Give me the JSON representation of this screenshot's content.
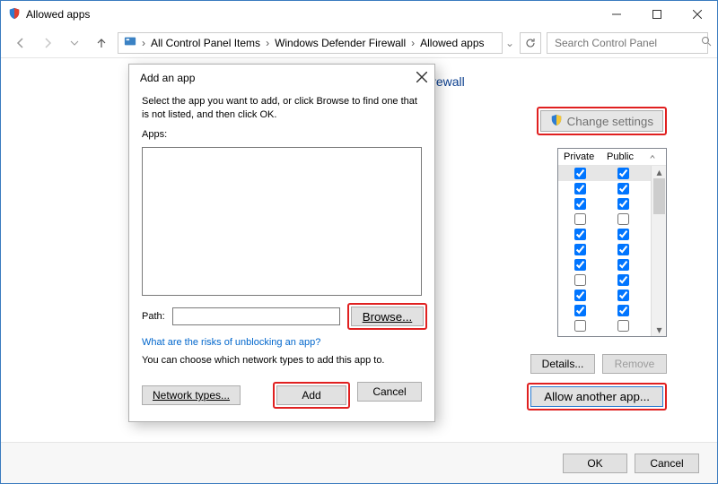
{
  "window": {
    "title": "Allowed apps"
  },
  "nav": {
    "crumbs": [
      "All Control Panel Items",
      "Windows Defender Firewall",
      "Allowed apps"
    ],
    "search_placeholder": "Search Control Panel"
  },
  "main": {
    "heading_suffix": "r Firewall",
    "change_settings": "Change settings",
    "columns": {
      "private": "Private",
      "public": "Public"
    },
    "rows": [
      {
        "private": true,
        "public": true,
        "selected": true
      },
      {
        "private": true,
        "public": true
      },
      {
        "private": true,
        "public": true
      },
      {
        "private": false,
        "public": false
      },
      {
        "private": true,
        "public": true
      },
      {
        "private": true,
        "public": true
      },
      {
        "private": true,
        "public": true
      },
      {
        "private": false,
        "public": true
      },
      {
        "private": true,
        "public": true
      },
      {
        "private": true,
        "public": true
      },
      {
        "private": false,
        "public": false
      }
    ],
    "details": "Details...",
    "remove": "Remove",
    "allow_another": "Allow another app..."
  },
  "footer": {
    "ok": "OK",
    "cancel": "Cancel"
  },
  "modal": {
    "title": "Add an app",
    "instruction": "Select the app you want to add, or click Browse to find one that is not listed, and then click OK.",
    "apps_label": "Apps:",
    "path_label": "Path:",
    "path_value": "",
    "browse": "Browse...",
    "risks_link": "What are the risks of unblocking an app?",
    "note": "You can choose which network types to add this app to.",
    "net_types": "Network types...",
    "add": "Add",
    "cancel": "Cancel"
  }
}
